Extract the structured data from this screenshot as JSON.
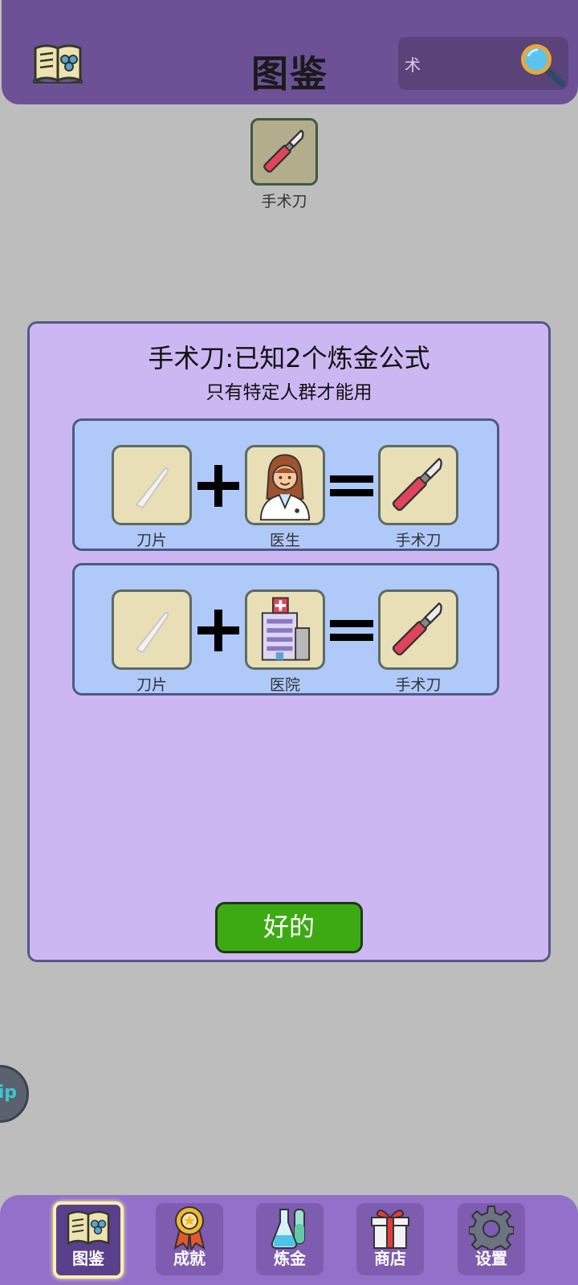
{
  "header": {
    "title": "图鉴",
    "search_value": "术"
  },
  "search_result": {
    "label": "手术刀",
    "icon": "scalpel-icon"
  },
  "modal": {
    "title": "手术刀:已知2个炼金公式",
    "subtitle": "只有特定人群才能用",
    "recipes": [
      {
        "a": "刀片",
        "b": "医生",
        "result": "手术刀"
      },
      {
        "a": "刀片",
        "b": "医院",
        "result": "手术刀"
      }
    ],
    "ok_label": "好的"
  },
  "float_tab_text": "ip",
  "nav": [
    {
      "label": "图鉴",
      "icon": "book-icon",
      "active": true
    },
    {
      "label": "成就",
      "icon": "medal-icon",
      "active": false
    },
    {
      "label": "炼金",
      "icon": "flask-icon",
      "active": false
    },
    {
      "label": "商店",
      "icon": "gift-icon",
      "active": false
    },
    {
      "label": "设置",
      "icon": "gear-icon",
      "active": false
    }
  ],
  "colors": {
    "header_bg": "#6d5196",
    "modal_bg": "#cdb7f3",
    "recipe_bg": "#afc9f9",
    "ok_button": "#3daa14",
    "nav_bg": "#9370c9"
  }
}
